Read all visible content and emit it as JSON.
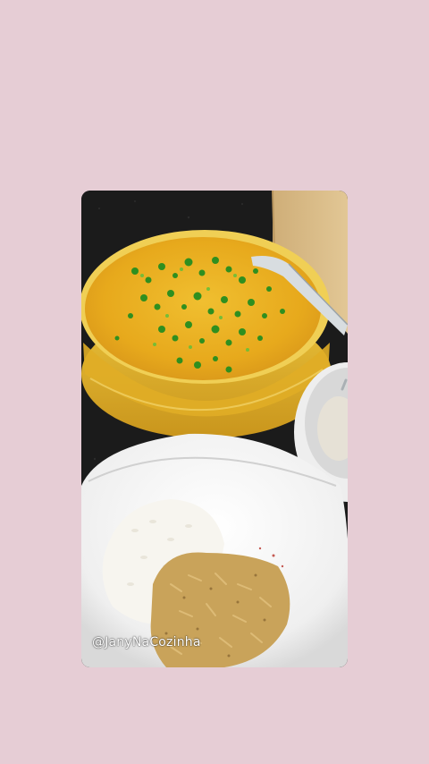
{
  "background_color": "#e6cdd5",
  "photo": {
    "description_icon": "food-photo",
    "watermark_text": "@JanyNaCozinha"
  },
  "colors": {
    "counter": "#1c1c1c",
    "cabinet": "#d9bd8a",
    "curry": "#e9b123",
    "bowl_glass": "#e9c64a",
    "green_onion": "#2f8f1f",
    "plate": "#f3f3f3",
    "rice": "#f6f4ef",
    "crispy_topping": "#c9a35a"
  }
}
